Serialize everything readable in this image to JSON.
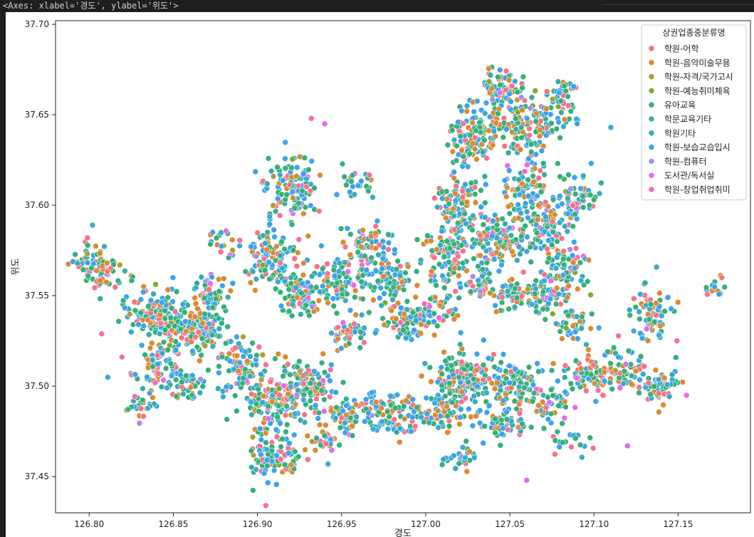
{
  "output": {
    "repr_text": "<Axes: xlabel='경도', ylabel='위도'>"
  },
  "chart_data": {
    "type": "scatter",
    "title": "",
    "xlabel": "경도",
    "ylabel": "위도",
    "xlim": [
      126.78,
      127.193
    ],
    "ylim": [
      37.43,
      37.702
    ],
    "xticks": [
      "126.80",
      "126.85",
      "126.90",
      "126.95",
      "127.00",
      "127.05",
      "127.10",
      "127.15"
    ],
    "yticks": [
      "37.45",
      "37.50",
      "37.55",
      "37.60",
      "37.65",
      "37.70"
    ],
    "grid": false,
    "legend_position": "top-right",
    "legend_title": "상권업종중분류명",
    "series": [
      {
        "name": "학원-어학",
        "color": "#f77189"
      },
      {
        "name": "학원-음악미술무용",
        "color": "#dc8932"
      },
      {
        "name": "학원-자격/국가고시",
        "color": "#ae9d31"
      },
      {
        "name": "학원-예능취미체육",
        "color": "#77ab31"
      },
      {
        "name": "유아교육",
        "color": "#33b07a"
      },
      {
        "name": "학문교육기타",
        "color": "#36ada4"
      },
      {
        "name": "학원기타",
        "color": "#38a9c5"
      },
      {
        "name": "학원-보습교습입시",
        "color": "#3ba3ec"
      },
      {
        "name": "학원-컴퓨터",
        "color": "#a48cf4"
      },
      {
        "name": "도서관/독서실",
        "color": "#e866f4"
      },
      {
        "name": "학원-창업취업취미",
        "color": "#f668c2"
      }
    ],
    "clusters": [
      [
        126.8,
        37.57,
        0.01,
        0.008,
        45
      ],
      [
        126.81,
        37.56,
        0.01,
        0.008,
        35
      ],
      [
        126.84,
        37.54,
        0.016,
        0.012,
        150
      ],
      [
        126.86,
        37.53,
        0.016,
        0.012,
        130
      ],
      [
        126.84,
        37.51,
        0.012,
        0.01,
        80
      ],
      [
        126.87,
        37.55,
        0.01,
        0.01,
        60
      ],
      [
        126.86,
        37.5,
        0.01,
        0.008,
        40
      ],
      [
        126.83,
        37.49,
        0.008,
        0.006,
        25
      ],
      [
        126.89,
        37.51,
        0.012,
        0.014,
        90
      ],
      [
        126.91,
        37.49,
        0.014,
        0.016,
        130
      ],
      [
        126.93,
        37.5,
        0.014,
        0.012,
        110
      ],
      [
        126.905,
        37.46,
        0.01,
        0.01,
        60
      ],
      [
        126.92,
        37.46,
        0.008,
        0.008,
        30
      ],
      [
        126.955,
        37.485,
        0.012,
        0.008,
        70
      ],
      [
        126.94,
        37.47,
        0.008,
        0.006,
        30
      ],
      [
        126.98,
        37.485,
        0.014,
        0.01,
        90
      ],
      [
        127.01,
        37.485,
        0.014,
        0.012,
        90
      ],
      [
        127.025,
        37.505,
        0.016,
        0.012,
        140
      ],
      [
        127.055,
        37.5,
        0.014,
        0.012,
        110
      ],
      [
        127.045,
        37.48,
        0.012,
        0.008,
        60
      ],
      [
        127.075,
        37.49,
        0.01,
        0.008,
        40
      ],
      [
        127.02,
        37.46,
        0.008,
        0.006,
        25
      ],
      [
        127.1,
        37.505,
        0.016,
        0.008,
        90
      ],
      [
        127.14,
        37.5,
        0.012,
        0.008,
        60
      ],
      [
        127.135,
        37.54,
        0.01,
        0.012,
        80
      ],
      [
        127.12,
        37.51,
        0.01,
        0.008,
        40
      ],
      [
        127.07,
        37.55,
        0.012,
        0.01,
        70
      ],
      [
        127.09,
        37.535,
        0.01,
        0.008,
        40
      ],
      [
        127.17,
        37.555,
        0.006,
        0.006,
        15
      ],
      [
        127.085,
        37.47,
        0.01,
        0.006,
        20
      ],
      [
        126.92,
        37.61,
        0.012,
        0.016,
        120
      ],
      [
        126.91,
        37.57,
        0.014,
        0.012,
        110
      ],
      [
        126.925,
        37.55,
        0.012,
        0.01,
        80
      ],
      [
        126.95,
        37.56,
        0.014,
        0.012,
        110
      ],
      [
        126.98,
        37.56,
        0.012,
        0.01,
        90
      ],
      [
        126.965,
        37.58,
        0.01,
        0.008,
        50
      ],
      [
        126.99,
        37.535,
        0.012,
        0.01,
        70
      ],
      [
        126.955,
        37.53,
        0.01,
        0.008,
        50
      ],
      [
        127.01,
        37.57,
        0.012,
        0.014,
        90
      ],
      [
        127.02,
        37.6,
        0.012,
        0.016,
        110
      ],
      [
        127.03,
        37.64,
        0.012,
        0.016,
        130
      ],
      [
        127.045,
        37.665,
        0.01,
        0.01,
        70
      ],
      [
        127.06,
        37.64,
        0.014,
        0.016,
        120
      ],
      [
        127.08,
        37.655,
        0.008,
        0.012,
        50
      ],
      [
        127.04,
        37.58,
        0.016,
        0.014,
        140
      ],
      [
        127.07,
        37.59,
        0.014,
        0.014,
        110
      ],
      [
        127.09,
        37.605,
        0.01,
        0.012,
        60
      ],
      [
        127.05,
        37.55,
        0.01,
        0.008,
        50
      ],
      [
        127.085,
        37.565,
        0.012,
        0.01,
        60
      ],
      [
        127.005,
        37.54,
        0.008,
        0.008,
        40
      ],
      [
        126.96,
        37.61,
        0.008,
        0.006,
        25
      ],
      [
        126.88,
        37.58,
        0.008,
        0.006,
        20
      ],
      [
        127.06,
        37.61,
        0.01,
        0.01,
        60
      ],
      [
        127.03,
        37.555,
        0.008,
        0.006,
        40
      ]
    ],
    "outliers": [
      [
        126.799,
        37.582
      ],
      [
        126.802,
        37.589
      ],
      [
        126.94,
        37.645
      ],
      [
        126.932,
        37.648
      ],
      [
        127.11,
        37.643
      ],
      [
        127.06,
        37.448
      ],
      [
        126.905,
        37.434
      ],
      [
        126.942,
        37.457
      ],
      [
        127.12,
        37.467
      ],
      [
        127.176,
        37.56
      ],
      [
        127.09,
        37.645
      ],
      [
        127.155,
        37.495
      ]
    ]
  }
}
